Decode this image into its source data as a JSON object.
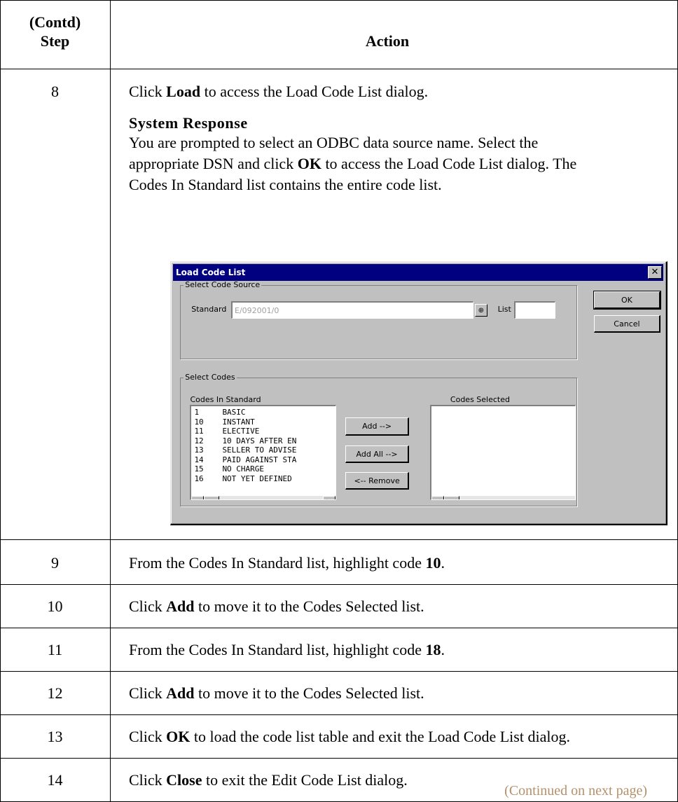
{
  "header": {
    "step_line1": "(Contd)",
    "step_line2": "Step",
    "action": "Action"
  },
  "rows": [
    {
      "step": "8",
      "pre": "Click ",
      "bold": "Load",
      "post": " to access the Load Code List dialog."
    },
    {
      "step": "9",
      "pre": "From the Codes In Standard list, highlight code ",
      "bold": "10",
      "post": "."
    },
    {
      "step": "10",
      "pre": "Click ",
      "bold": "Add",
      "post": " to move it to the Codes Selected list."
    },
    {
      "step": "11",
      "pre": "From the Codes In Standard list, highlight code ",
      "bold": "18",
      "post": "."
    },
    {
      "step": "12",
      "pre": "Click ",
      "bold": "Add",
      "post": " to move it to the Codes Selected list."
    },
    {
      "step": "13",
      "pre": "Click ",
      "bold": "OK",
      "post": " to load the code list table and exit the Load Code List dialog."
    },
    {
      "step": "14",
      "pre": "Click ",
      "bold": "Close",
      "post": " to exit the Edit Code List dialog."
    }
  ],
  "system_response": {
    "heading": "System Response",
    "line1": "You are prompted to select an ODBC data source name. Select the",
    "line2_pre": "appropriate DSN and click ",
    "line2_bold": "OK",
    "line2_post": " to access the Load Code List dialog. The",
    "line3": "Codes In Standard list contains the entire code list."
  },
  "continued": "(Continued on next page)",
  "dialog": {
    "title": "Load Code List",
    "close_glyph": "✕",
    "select_code_source_label": "Select Code Source",
    "standard_label": "Standard",
    "standard_value": "E/092001/0",
    "list_label": "List",
    "list_value": "",
    "ok_label": "OK",
    "cancel_label": "Cancel",
    "select_codes_label": "Select Codes",
    "codes_in_standard_label": "Codes In Standard",
    "codes_selected_label": "Codes Selected",
    "add_label": "Add -->",
    "add_all_label": "Add All -->",
    "remove_label": "<-- Remove",
    "codes": [
      {
        "code": "1",
        "desc": "BASIC"
      },
      {
        "code": "10",
        "desc": "INSTANT"
      },
      {
        "code": "11",
        "desc": "ELECTIVE"
      },
      {
        "code": "12",
        "desc": "10 DAYS AFTER EN"
      },
      {
        "code": "13",
        "desc": "SELLER TO ADVISE"
      },
      {
        "code": "14",
        "desc": "PAID AGAINST STA"
      },
      {
        "code": "15",
        "desc": "NO CHARGE"
      },
      {
        "code": "16",
        "desc": "NOT YET DEFINED"
      }
    ]
  }
}
